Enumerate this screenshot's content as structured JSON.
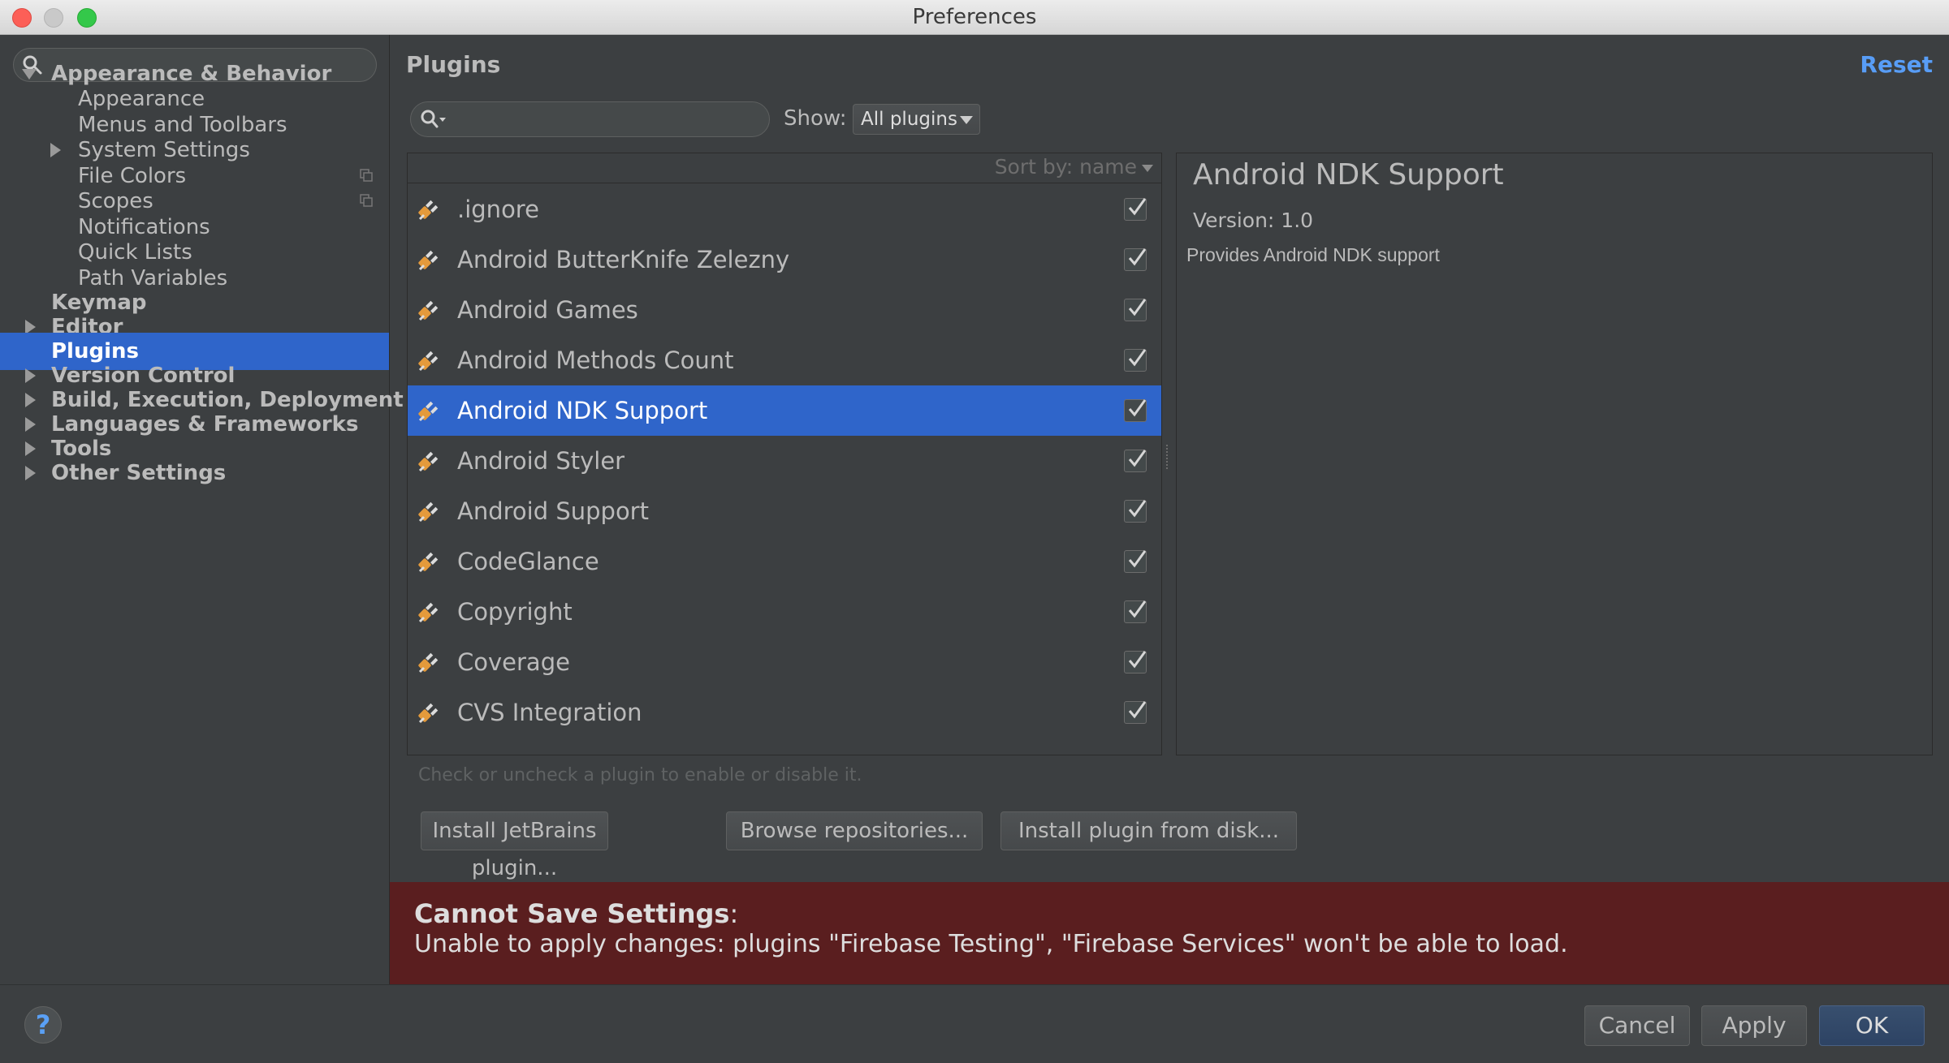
{
  "window": {
    "title": "Preferences"
  },
  "sidebar": {
    "search_placeholder": "",
    "items": [
      {
        "label": "Appearance & Behavior",
        "expanded": true
      },
      {
        "label": "Appearance"
      },
      {
        "label": "Menus and Toolbars"
      },
      {
        "label": "System Settings"
      },
      {
        "label": "File Colors"
      },
      {
        "label": "Scopes"
      },
      {
        "label": "Notifications"
      },
      {
        "label": "Quick Lists"
      },
      {
        "label": "Path Variables"
      },
      {
        "label": "Keymap"
      },
      {
        "label": "Editor"
      },
      {
        "label": "Plugins",
        "selected": true
      },
      {
        "label": "Version Control"
      },
      {
        "label": "Build, Execution, Deployment"
      },
      {
        "label": "Languages & Frameworks"
      },
      {
        "label": "Tools"
      },
      {
        "label": "Other Settings"
      }
    ]
  },
  "main": {
    "title": "Plugins",
    "reset_label": "Reset",
    "search_placeholder": "",
    "show_label": "Show:",
    "show_value": "All plugins",
    "sort_label": "Sort by: name",
    "plugins": [
      {
        "name": ".ignore",
        "enabled": true
      },
      {
        "name": "Android ButterKnife Zelezny",
        "enabled": true
      },
      {
        "name": "Android Games",
        "enabled": true
      },
      {
        "name": "Android Methods Count",
        "enabled": true
      },
      {
        "name": "Android NDK Support",
        "enabled": true,
        "selected": true
      },
      {
        "name": "Android Styler",
        "enabled": true
      },
      {
        "name": "Android Support",
        "enabled": true
      },
      {
        "name": "CodeGlance",
        "enabled": true
      },
      {
        "name": "Copyright",
        "enabled": true
      },
      {
        "name": "Coverage",
        "enabled": true
      },
      {
        "name": "CVS Integration",
        "enabled": true
      }
    ],
    "details": {
      "title": "Android NDK Support",
      "version": "Version: 1.0",
      "description": "Provides Android NDK support"
    },
    "hint": "Check or uncheck a plugin to enable or disable it.",
    "buttons": {
      "install_jetbrains": "Install JetBrains plugin...",
      "browse_repos": "Browse repositories...",
      "install_disk": "Install plugin from disk..."
    },
    "error": {
      "title": "Cannot Save Settings",
      "colon": ":",
      "message": "Unable to apply changes: plugins \"Firebase Testing\", \"Firebase Services\" won't be able to load."
    }
  },
  "footer": {
    "help": "?",
    "cancel": "Cancel",
    "apply": "Apply",
    "ok": "OK"
  },
  "colors": {
    "background": "#3c3f41",
    "selection": "#2f65ca",
    "link": "#589df6",
    "error_bg": "#5a1e1f"
  }
}
